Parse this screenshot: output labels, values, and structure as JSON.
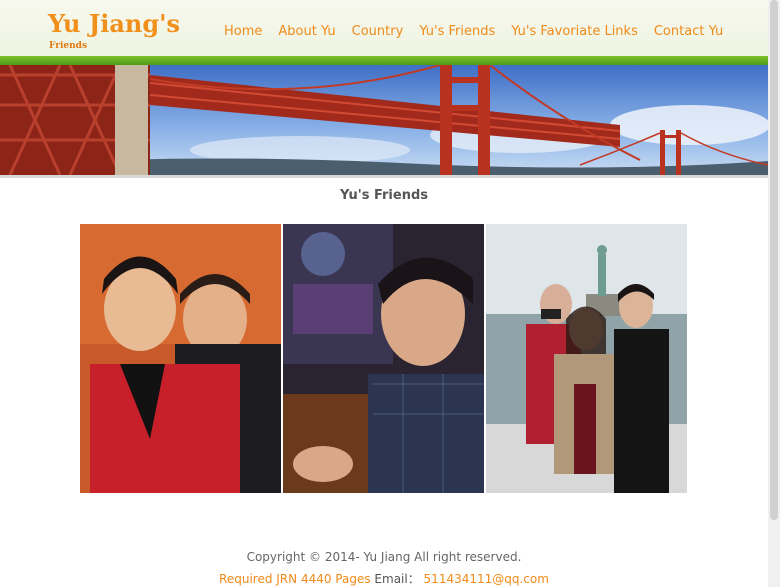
{
  "header": {
    "logo_title": "Yu Jiang's",
    "logo_subtitle": "Friends",
    "nav": [
      {
        "label": "Home"
      },
      {
        "label": "About Yu"
      },
      {
        "label": "Country"
      },
      {
        "label": "Yu's Friends"
      },
      {
        "label": "Yu's Favoriate Links"
      },
      {
        "label": "Contact Yu"
      }
    ]
  },
  "banner": {
    "subject": "golden-gate-bridge"
  },
  "main": {
    "title": "Yu's Friends"
  },
  "photos": [
    {
      "subject": "two-people-selfie"
    },
    {
      "subject": "man-in-restaurant"
    },
    {
      "subject": "three-friends-statue-of-liberty"
    }
  ],
  "footer": {
    "copyright": "Copyright © 2014- Yu Jiang All right reserved.",
    "crn_text": "Required JRN 4440 Pages",
    "email_label": "Email：",
    "email_value": "511434111@qq.com"
  },
  "colors": {
    "accent": "#f08a1a",
    "green_bar": "#5aa51c"
  }
}
